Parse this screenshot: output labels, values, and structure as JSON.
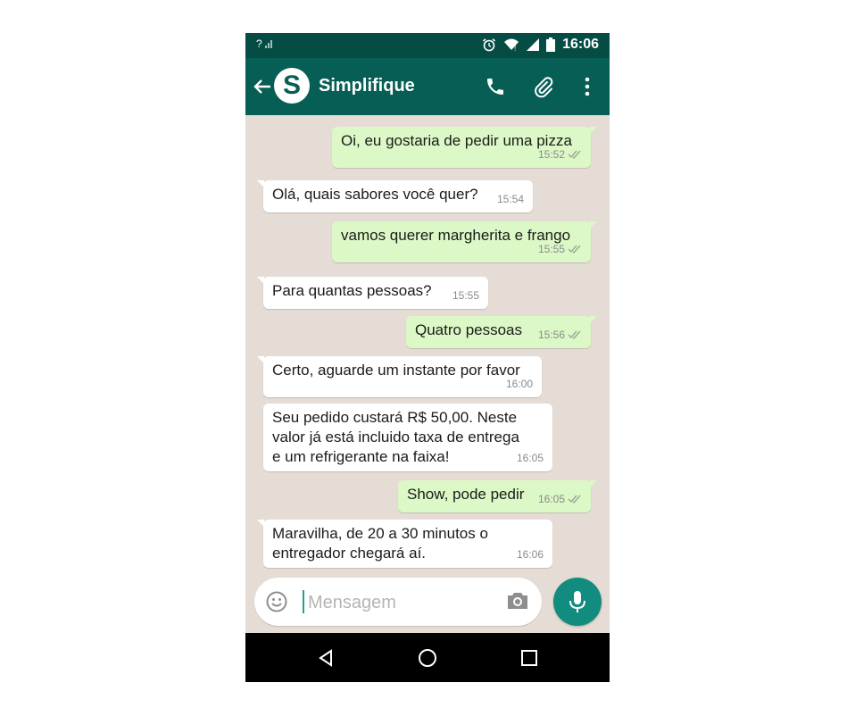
{
  "status_bar": {
    "time": "16:06",
    "signal_left": "?",
    "icons": [
      "signal-icon",
      "alarm-icon",
      "wifi-icon",
      "cell-signal-icon",
      "battery-icon"
    ]
  },
  "header": {
    "avatar_letter": "S",
    "contact_name": "Simplifique",
    "icons": [
      "back-arrow-icon",
      "phone-icon",
      "paperclip-icon",
      "more-vert-icon"
    ]
  },
  "messages": [
    {
      "dir": "out",
      "text": "Oi, eu gostaria de pedir uma pizza",
      "time": "15:52"
    },
    {
      "dir": "in",
      "text": "Olá, quais sabores você quer?",
      "time": "15:54"
    },
    {
      "dir": "out",
      "text": "vamos querer margherita e frango",
      "time": "15:55"
    },
    {
      "dir": "in",
      "text": "Para quantas pessoas?",
      "time": "15:55"
    },
    {
      "dir": "out",
      "text": "Quatro pessoas",
      "time": "15:56"
    },
    {
      "dir": "in",
      "text": "Certo, aguarde um instante por favor",
      "time": "16:00"
    },
    {
      "dir": "in",
      "text": "Seu pedido custará R$ 50,00. Neste\nvalor já está incluido taxa de entrega\ne um refrigerante na faixa!",
      "time": "16:05"
    },
    {
      "dir": "out",
      "text": "Show, pode pedir",
      "time": "16:05"
    },
    {
      "dir": "in",
      "text": "Maravilha, de 20 a 30 minutos o\nentregador chegará aí.",
      "time": "16:06"
    }
  ],
  "composer": {
    "placeholder": "Mensagem"
  },
  "colors": {
    "header": "#075e54",
    "status_bar": "#054d44",
    "outgoing_bubble": "#dcf8c6",
    "incoming_bubble": "#ffffff",
    "chat_background": "#e5ddd5",
    "mic_button": "#128c7e"
  }
}
